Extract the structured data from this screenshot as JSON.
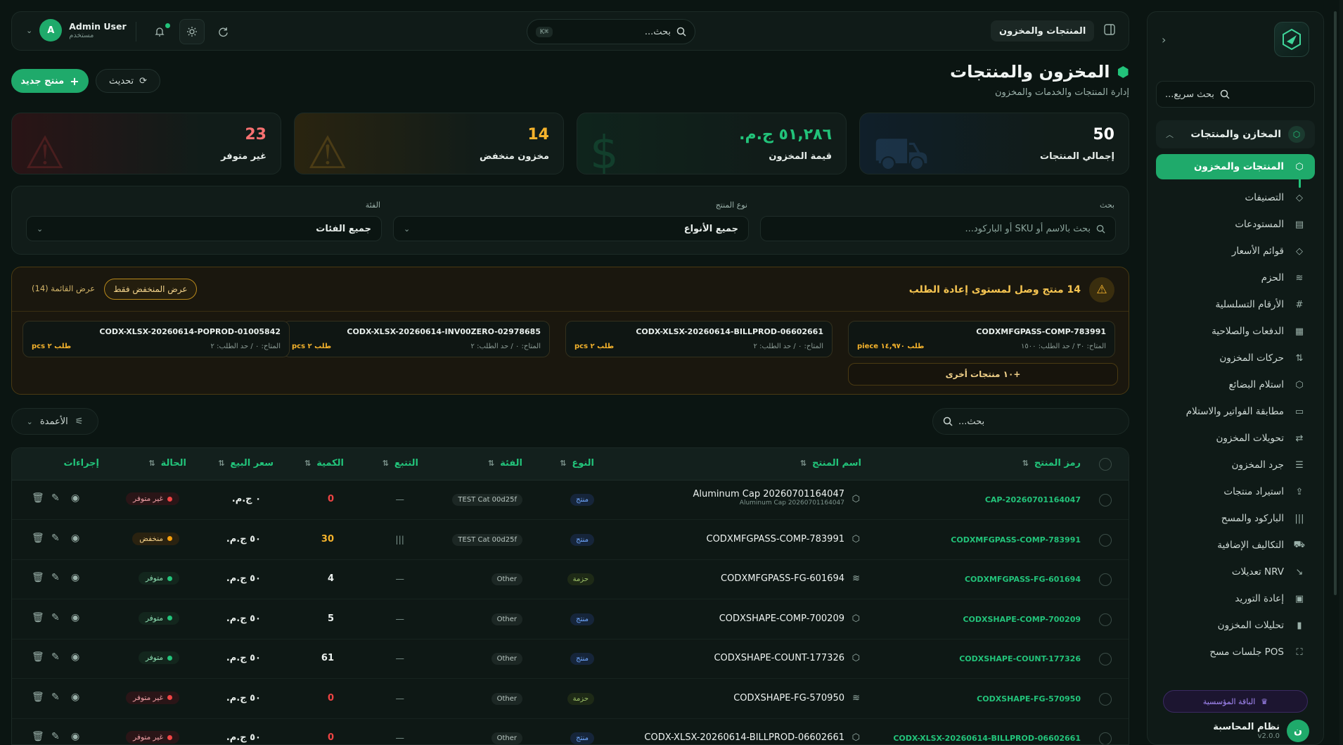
{
  "topbar": {
    "user_name": "Admin User",
    "user_role": "مستخدم",
    "user_initial": "A",
    "search_placeholder": "بحث...",
    "search_shortcut": "⌘K",
    "breadcrumb": "المنتجات والمخزون"
  },
  "sidebar": {
    "quick_search": "بحث سريع...",
    "group_label": "المخازن والمنتجات",
    "items": [
      {
        "label": "المنتجات والمخزون",
        "icon": "cube-icon",
        "active": true
      },
      {
        "label": "التصنيفات",
        "icon": "tag-icon"
      },
      {
        "label": "المستودعات",
        "icon": "warehouse-icon"
      },
      {
        "label": "قوائم الأسعار",
        "icon": "price-tag-icon"
      },
      {
        "label": "الحزم",
        "icon": "layers-icon"
      },
      {
        "label": "الأرقام التسلسلية",
        "icon": "hash-icon"
      },
      {
        "label": "الدفعات والصلاحية",
        "icon": "calendar-icon"
      },
      {
        "label": "حركات المخزون",
        "icon": "arrows-updown-icon"
      },
      {
        "label": "استلام البضائع",
        "icon": "package-icon"
      },
      {
        "label": "مطابقة الفواتير والاستلام",
        "icon": "clipboard-icon"
      },
      {
        "label": "تحويلات المخزون",
        "icon": "transfer-icon"
      },
      {
        "label": "جرد المخزون",
        "icon": "checklist-icon"
      },
      {
        "label": "استيراد منتجات",
        "icon": "upload-icon"
      },
      {
        "label": "الباركود والمسح",
        "icon": "barcode-icon"
      },
      {
        "label": "التكاليف الإضافية",
        "icon": "truck-icon"
      },
      {
        "label": "NRV تعديلات",
        "icon": "trend-down-icon"
      },
      {
        "label": "إعادة التوريد",
        "icon": "reorder-icon"
      },
      {
        "label": "تحليلات المخزون",
        "icon": "bar-chart-icon"
      },
      {
        "label": "POS جلسات مسح",
        "icon": "scan-icon"
      }
    ],
    "plan_label": "الباقة المؤسسية",
    "system_name": "نظام المحاسبة",
    "system_version": "v2.0.0",
    "system_initial": "ن"
  },
  "page": {
    "title": "المخزون والمنتجات",
    "subtitle": "إدارة المنتجات والخدمات والمخزون",
    "new_button": "منتج جديد",
    "refresh_button": "تحديث"
  },
  "stats": [
    {
      "value": "50",
      "label": "إجمالي المنتجات",
      "color": "#ffffff"
    },
    {
      "value": "٥١,٢٨٦ ج.م.",
      "label": "قيمة المخزون",
      "color": "#22c37a"
    },
    {
      "value": "14",
      "label": "مخزون منخفض",
      "color": "#f5b32c"
    },
    {
      "value": "23",
      "label": "غير متوفر",
      "color": "#f87171"
    }
  ],
  "filters": {
    "search_label": "بحث",
    "search_placeholder": "بحث بالاسم أو SKU أو الباركود...",
    "type_label": "نوع المنتج",
    "type_value": "جميع الأنواع",
    "category_label": "الفئة",
    "category_value": "جميع الفئات"
  },
  "alert": {
    "title": "14 منتج وصل لمستوى إعادة الطلب",
    "low_only_button": "عرض المنخفض فقط",
    "view_list_link": "عرض القائمة (14)",
    "more_button": "+١٠ منتجات أخرى",
    "cards": [
      {
        "code": "CODXMFGPASS-COMP-783991",
        "meta": "المتاح: ٣٠ / حد الطلب: ١٥٠٠",
        "req": "طلب ١٤,٩٧٠ piece"
      },
      {
        "code": "CODX-XLSX-20260614-BILLPROD-06602661",
        "meta": "المتاح: ٠ / حد الطلب: ٢",
        "req": "طلب ٢ pcs"
      },
      {
        "code": "CODX-XLSX-20260614-INV00ZERO-02978685",
        "meta": "المتاح: ٠ / حد الطلب: ٢",
        "req": "طلب ٢ pcs"
      },
      {
        "code": "CODX-XLSX-20260614-POPROD-01005842",
        "meta": "المتاح: ٠ / حد الطلب: ٢",
        "req": "طلب ٢ pcs"
      }
    ]
  },
  "table": {
    "search_placeholder": "بحث...",
    "columns_button": "الأعمدة",
    "headers": {
      "code": "رمز المنتج",
      "name": "اسم المنتج",
      "type": "النوع",
      "category": "الفئة",
      "tracking": "التتبع",
      "qty": "الكمية",
      "price": "سعر البيع",
      "status": "الحالة",
      "actions": "إجراءات"
    },
    "rows": [
      {
        "code": "CAP-20260701164047",
        "name": "Aluminum Cap 20260701164047",
        "sub": "Aluminum Cap 20260701164047",
        "icon": "box-icon",
        "type": "منتج",
        "category": "TEST Cat 00d25f",
        "tracking": "—",
        "qty": "0",
        "price": "٠ ج.م.",
        "status": "غير متوفر",
        "state": "out"
      },
      {
        "code": "CODXMFGPASS-COMP-783991",
        "name": "CODXMFGPASS-COMP-783991",
        "sub": "",
        "icon": "box-icon",
        "type": "منتج",
        "category": "TEST Cat 00d25f",
        "tracking": "|||",
        "qty": "30",
        "price": "٥٠ ج.م.",
        "status": "منخفض",
        "state": "low"
      },
      {
        "code": "CODXMFGPASS-FG-601694",
        "name": "CODXMFGPASS-FG-601694",
        "sub": "",
        "icon": "layers-icon",
        "type": "حزمة",
        "category": "Other",
        "tracking": "—",
        "qty": "4",
        "price": "٥٠ ج.م.",
        "status": "متوفر",
        "state": "ok"
      },
      {
        "code": "CODXSHAPE-COMP-700209",
        "name": "CODXSHAPE-COMP-700209",
        "sub": "",
        "icon": "box-icon",
        "type": "منتج",
        "category": "Other",
        "tracking": "—",
        "qty": "5",
        "price": "٥٠ ج.م.",
        "status": "متوفر",
        "state": "ok"
      },
      {
        "code": "CODXSHAPE-COUNT-177326",
        "name": "CODXSHAPE-COUNT-177326",
        "sub": "",
        "icon": "box-icon",
        "type": "منتج",
        "category": "Other",
        "tracking": "—",
        "qty": "61",
        "price": "٥٠ ج.م.",
        "status": "متوفر",
        "state": "ok"
      },
      {
        "code": "CODXSHAPE-FG-570950",
        "name": "CODXSHAPE-FG-570950",
        "sub": "",
        "icon": "layers-icon",
        "type": "حزمة",
        "category": "Other",
        "tracking": "—",
        "qty": "0",
        "price": "٥٠ ج.م.",
        "status": "غير متوفر",
        "state": "out"
      },
      {
        "code": "CODX-XLSX-20260614-BILLPROD-06602661",
        "name": "CODX-XLSX-20260614-BILLPROD-06602661",
        "sub": "",
        "icon": "box-icon",
        "type": "منتج",
        "category": "Other",
        "tracking": "—",
        "qty": "0",
        "price": "٥٠ ج.م.",
        "status": "غير متوفر",
        "state": "out"
      }
    ]
  },
  "colors": {
    "accent": "#1faa6b",
    "warning": "#f5b32c",
    "danger": "#ef4444"
  }
}
